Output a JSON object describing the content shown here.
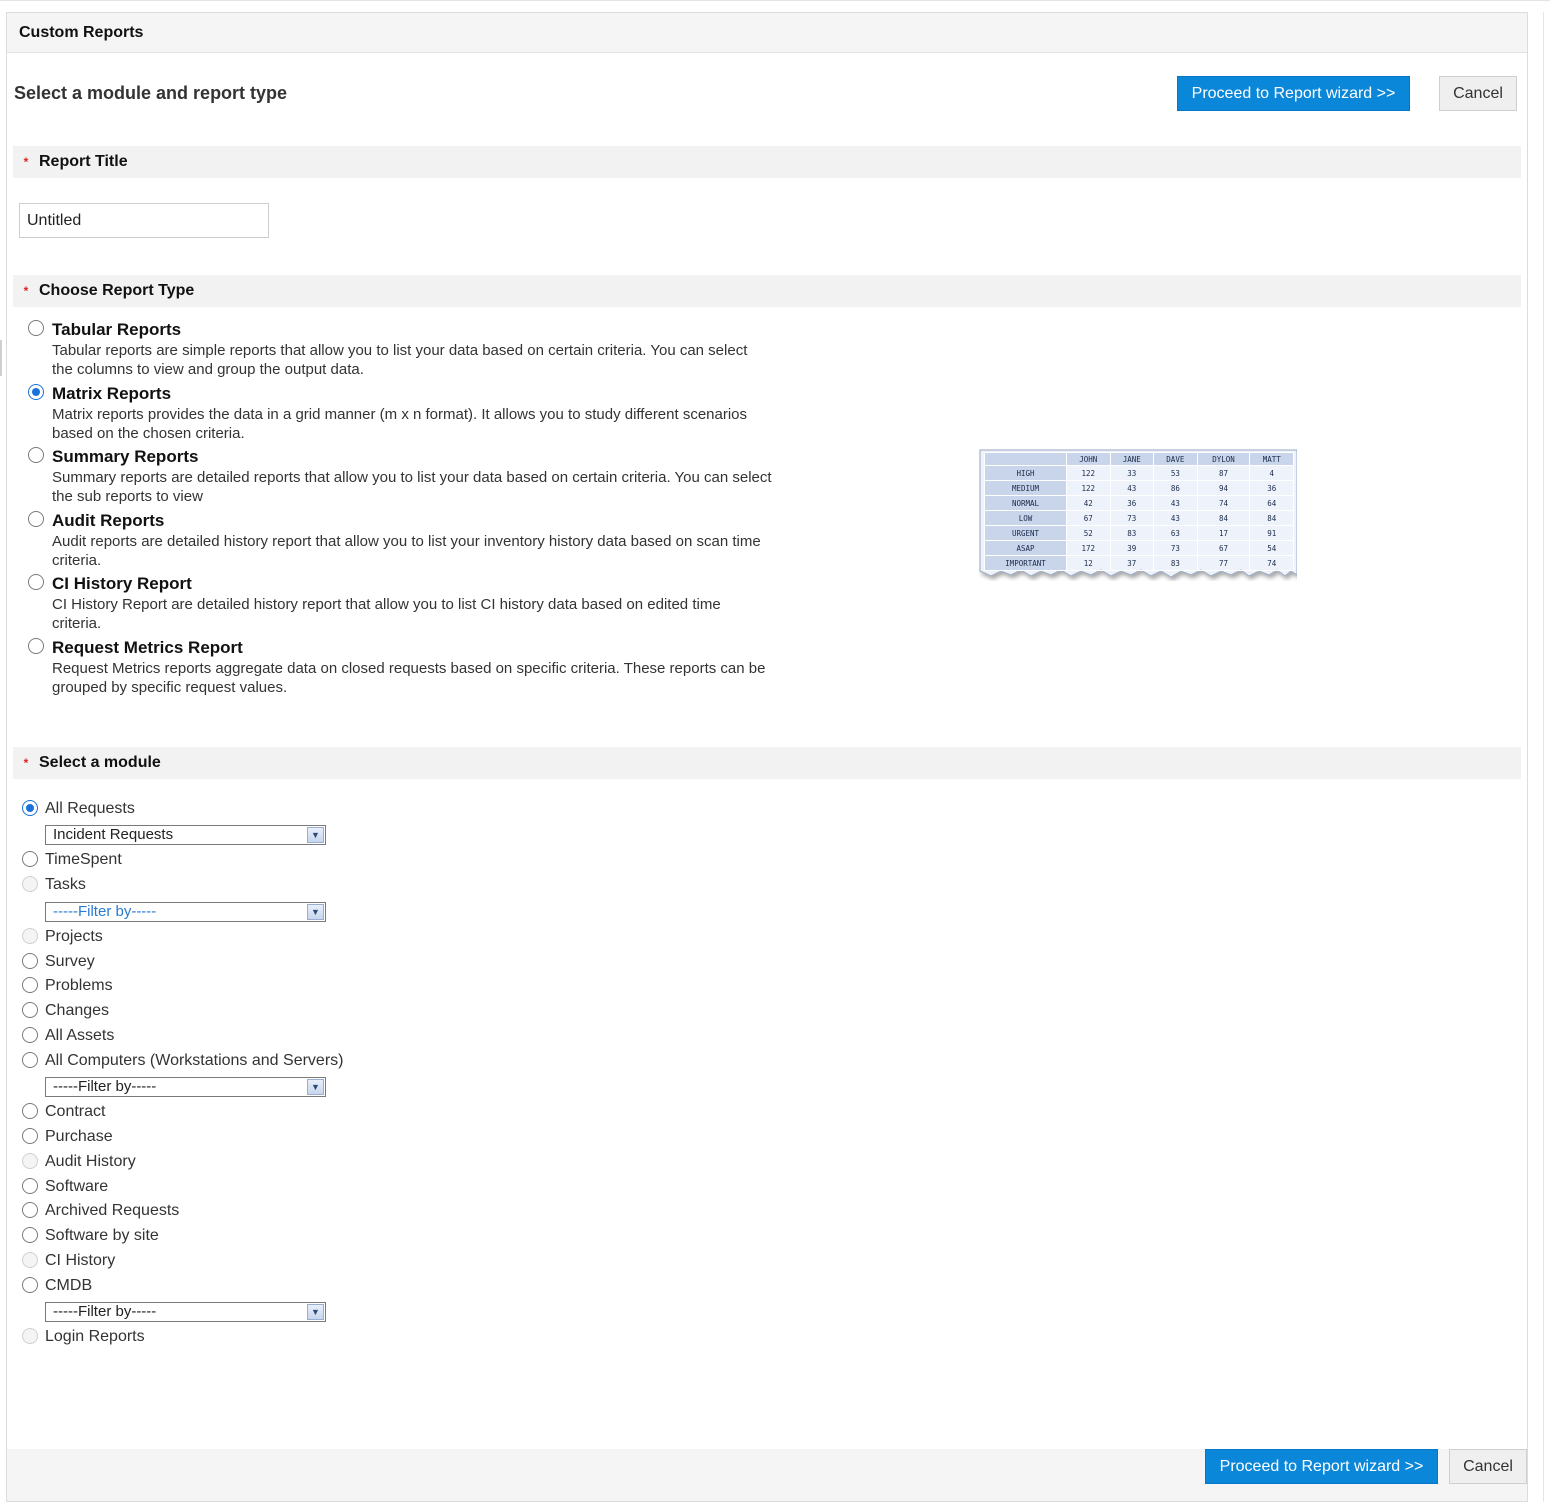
{
  "header": {
    "title": "Custom Reports"
  },
  "subtitle": "Select a module and report type",
  "buttons": {
    "proceed": "Proceed to Report wizard >>",
    "cancel": "Cancel"
  },
  "sections": {
    "report_title": "Report Title",
    "report_type": "Choose Report Type",
    "module": "Select a module",
    "required_mark": "*"
  },
  "report_title_value": "Untitled",
  "report_types": [
    {
      "title": "Tabular Reports",
      "desc": "Tabular reports are simple reports that allow you to list your data based on certain criteria. You can select the columns to view and group the output data.",
      "selected": false
    },
    {
      "title": "Matrix Reports",
      "desc": "Matrix reports provides the data in a grid manner (m x n format). It allows you to study different scenarios based on the chosen criteria.",
      "selected": true
    },
    {
      "title": "Summary Reports",
      "desc": "Summary reports are detailed reports that allow you to list your data based on certain criteria. You can select the sub reports to view",
      "selected": false
    },
    {
      "title": "Audit Reports",
      "desc": "Audit reports are detailed history report that allow you to list your inventory history data based on scan time criteria.",
      "selected": false
    },
    {
      "title": "CI History Report",
      "desc": "CI History Report are detailed history report that allow you to list CI history data based on edited time criteria.",
      "selected": false
    },
    {
      "title": "Request Metrics Report",
      "desc": "Request Metrics reports aggregate data on closed requests based on specific criteria. These reports can be grouped by specific request values.",
      "selected": false
    }
  ],
  "preview_table": {
    "columns": [
      "JOHN",
      "JANE",
      "DAVE",
      "DYLON",
      "MATT"
    ],
    "rows": [
      {
        "label": "HIGH",
        "values": [
          "122",
          "33",
          "53",
          "87",
          "4"
        ]
      },
      {
        "label": "MEDIUM",
        "values": [
          "122",
          "43",
          "86",
          "94",
          "36"
        ]
      },
      {
        "label": "NORMAL",
        "values": [
          "42",
          "36",
          "43",
          "74",
          "64"
        ]
      },
      {
        "label": "LOW",
        "values": [
          "67",
          "73",
          "43",
          "84",
          "84"
        ]
      },
      {
        "label": "URGENT",
        "values": [
          "52",
          "83",
          "63",
          "17",
          "91"
        ]
      },
      {
        "label": "ASAP",
        "values": [
          "172",
          "39",
          "73",
          "67",
          "54"
        ]
      },
      {
        "label": "IMPORTANT",
        "values": [
          "12",
          "37",
          "83",
          "77",
          "74"
        ]
      }
    ]
  },
  "modules": [
    {
      "label": "All Requests",
      "state": "checked"
    },
    {
      "label": "TimeSpent",
      "state": "normal"
    },
    {
      "label": "Tasks",
      "state": "disabled"
    },
    {
      "label": "Projects",
      "state": "disabled"
    },
    {
      "label": "Survey",
      "state": "normal"
    },
    {
      "label": "Problems",
      "state": "normal"
    },
    {
      "label": "Changes",
      "state": "normal"
    },
    {
      "label": "All Assets",
      "state": "normal"
    },
    {
      "label": "All Computers (Workstations and Servers)",
      "state": "normal"
    },
    {
      "label": "Contract",
      "state": "normal"
    },
    {
      "label": "Purchase",
      "state": "normal"
    },
    {
      "label": "Audit History",
      "state": "disabled"
    },
    {
      "label": "Software",
      "state": "normal"
    },
    {
      "label": "Archived Requests",
      "state": "normal"
    },
    {
      "label": "Software by site",
      "state": "normal"
    },
    {
      "label": "CI History",
      "state": "disabled"
    },
    {
      "label": "CMDB",
      "state": "normal"
    },
    {
      "label": "Login Reports",
      "state": "disabled"
    }
  ],
  "selects": {
    "requests": "Incident Requests",
    "tasks": "-----Filter by-----",
    "computers": "-----Filter by-----",
    "cmdb": "-----Filter by-----"
  },
  "colors": {
    "primary": "#0a87d8",
    "required": "#e02020",
    "radio_checked": "#1a73d8"
  }
}
